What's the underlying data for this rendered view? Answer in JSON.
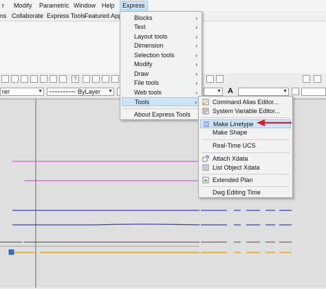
{
  "menubar": {
    "items": [
      "r",
      "Modify",
      "Parametric",
      "Window",
      "Help",
      "Express"
    ]
  },
  "tabs": {
    "items": [
      "ns",
      "Collaborate",
      "Express Tools",
      "Featured Apps"
    ]
  },
  "toolbar": {
    "layer_combo": "rer",
    "linetype_combo": "ByLayer"
  },
  "express_menu": {
    "items": [
      "Blocks",
      "Text",
      "Layout tools",
      "Dimension",
      "Selection tools",
      "Modify",
      "Draw",
      "File tools",
      "Web tools",
      "Tools",
      "About Express Tools"
    ],
    "active": "Tools"
  },
  "tools_submenu": {
    "items": [
      "Command Alias Editor...",
      "System Variable Editor...",
      "Make Linetype",
      "Make Shape",
      "Real-Time UCS",
      "Attach Xdata",
      "List Object Xdata",
      "Extended Plan",
      "Dwg Editing Time"
    ],
    "active": "Make Linetype"
  },
  "colors": {
    "highlight": "#cce4f7",
    "annotation_arrow": "#d6202a",
    "magenta_line": "#d75ad2",
    "blue_line": "#3a3ad0",
    "yellow_line": "#f2a900"
  },
  "icons": {
    "submenu_arrow": "chevron-right-icon",
    "alias_editor": "alias-editor-icon",
    "sysvar_editor": "sysvar-editor-icon",
    "make_linetype": "make-linetype-icon",
    "attach_xdata": "attach-xdata-icon",
    "list_xdata": "list-xdata-icon",
    "extended_plan": "extended-plan-icon"
  }
}
